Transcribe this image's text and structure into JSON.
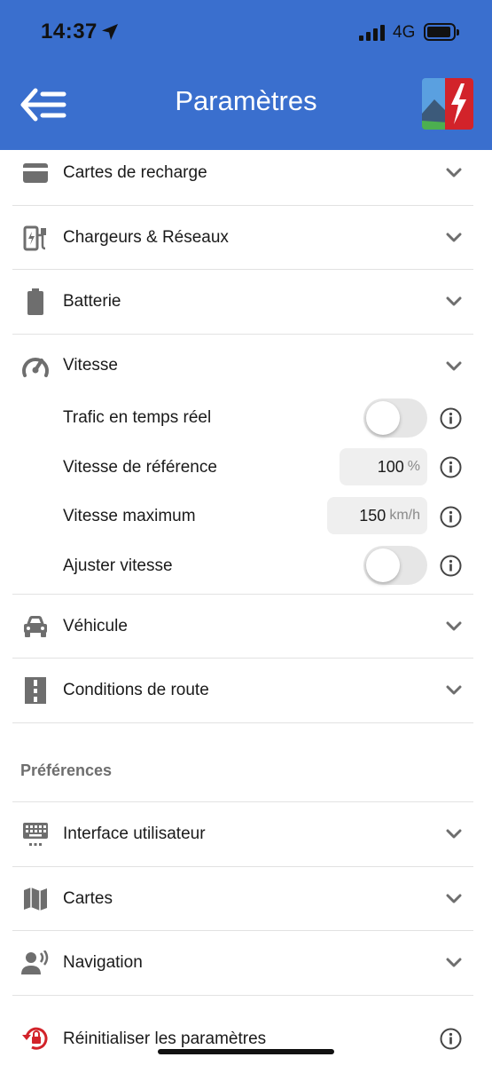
{
  "status_bar": {
    "time": "14:37",
    "network": "4G"
  },
  "header": {
    "title": "Paramètres"
  },
  "colors": {
    "header": "#3a6fce",
    "icon_gray": "#6e6e6e",
    "field_bg": "#efefef",
    "logo_red": "#d2232a"
  },
  "settings": {
    "charge_cards": "Cartes de recharge",
    "chargers_networks": "Chargeurs & Réseaux",
    "battery": "Batterie",
    "speed": "Vitesse",
    "vehicle": "Véhicule",
    "road_conditions": "Conditions de route"
  },
  "speed_options": {
    "realtime_traffic": {
      "label": "Trafic en temps réel",
      "enabled": false
    },
    "reference_speed": {
      "label": "Vitesse de référence",
      "value": "100",
      "unit": "%"
    },
    "max_speed": {
      "label": "Vitesse maximum",
      "value": "150",
      "unit": "km/h"
    },
    "adjust_speed": {
      "label": "Ajuster vitesse",
      "enabled": false
    }
  },
  "preferences": {
    "title": "Préférences",
    "user_interface": "Interface utilisateur",
    "maps": "Cartes",
    "navigation": "Navigation",
    "reset": "Réinitialiser les paramètres"
  },
  "icons": [
    "location-arrow-icon",
    "signal-icon",
    "battery-status-icon",
    "back-menu-icon",
    "app-logo",
    "credit-card-icon",
    "ev-charger-icon",
    "battery-icon",
    "speedometer-icon",
    "car-icon",
    "road-icon",
    "keyboard-icon",
    "map-icon",
    "voice-navigation-icon",
    "reset-lock-icon",
    "info-icon",
    "chevron-down-icon"
  ]
}
